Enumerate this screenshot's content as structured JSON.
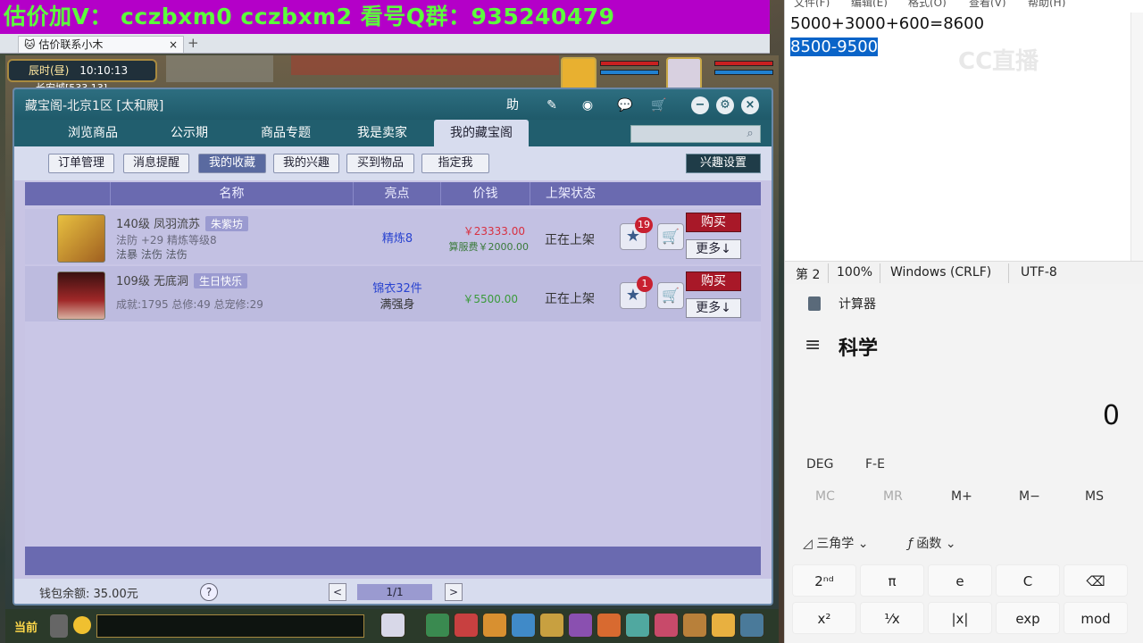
{
  "banner": {
    "text": "估价加V： cczbxm0   cczbxm2   看号Q群：935240479"
  },
  "browser": {
    "tab_label": "估价联系小木",
    "tab_close": "×",
    "tab_new": "+"
  },
  "game": {
    "time_label": "辰时(昼)",
    "clock": "10:10:13",
    "location": "长安城[533,13]",
    "chat_label": "当前"
  },
  "treasure": {
    "title": "藏宝阁-北京1区 [太和殿]",
    "help_label": "助",
    "nav_tabs": [
      {
        "label": "浏览商品"
      },
      {
        "label": "公示期"
      },
      {
        "label": "商品专题"
      },
      {
        "label": "我是卖家"
      },
      {
        "label": "我的藏宝阁"
      }
    ],
    "sub_tabs": [
      {
        "label": "订单管理"
      },
      {
        "label": "消息提醒"
      },
      {
        "label": "我的收藏"
      },
      {
        "label": "我的兴趣"
      },
      {
        "label": "买到物品"
      },
      {
        "label": "指定我"
      }
    ],
    "interest_settings": "兴趣设置",
    "columns": {
      "name": "名称",
      "highlight": "亮点",
      "price": "价钱",
      "status": "上架状态"
    },
    "rows": [
      {
        "name": "140级  凤羽流苏",
        "tag": "朱紫坊",
        "line1": "法防 +29  精炼等级8",
        "line2": "法暴  法伤  法伤",
        "highlight": "精炼8",
        "highlight2": "",
        "price": "￥23333.00",
        "fee": "算服费￥2000.00",
        "status": "正在上架",
        "fav_count": "19",
        "buy": "购买",
        "more": "更多↓"
      },
      {
        "name": "109级  无底洞",
        "tag": "生日快乐",
        "line1": "成就:1795  总修:49  总宠修:29",
        "line2": "",
        "highlight": "锦衣32件",
        "highlight2": "满强身",
        "price": "￥5500.00",
        "fee": "",
        "status": "正在上架",
        "fav_count": "1",
        "buy": "购买",
        "more": "更多↓"
      }
    ],
    "wallet": "钱包余额: 35.00元",
    "help": "?",
    "page": "1/1",
    "prev": "<",
    "next": ">"
  },
  "notepad": {
    "menu": [
      "文件(F)",
      "编辑(E)",
      "格式(O)",
      "查看(V)",
      "帮助(H)"
    ],
    "line1": "5000+3000+600=8600",
    "line2": "8500-9500",
    "watermark": "CC直播",
    "status": {
      "line": "第 2",
      "zoom": "100%",
      "eol": "Windows (CRLF)",
      "encoding": "UTF-8"
    }
  },
  "calculator": {
    "app_title": "计算器",
    "mode": "科学",
    "display": "0",
    "angle": "DEG",
    "fe": "F-E",
    "memory": [
      "MC",
      "MR",
      "M+",
      "M−",
      "MS"
    ],
    "trig": "三角学",
    "func": "函数",
    "keys_row1": [
      "2ⁿᵈ",
      "π",
      "e",
      "C",
      "⌫"
    ],
    "keys_row2": [
      "x²",
      "¹⁄x",
      "|x|",
      "exp",
      "mod"
    ]
  },
  "colors": {
    "banner_bg": "#b400c8",
    "banner_text": "#5cff3c",
    "window_title": "#1f5a6a",
    "buy": "#a81828",
    "price_red": "#d83040",
    "price_green": "#3a9a3a",
    "selection": "#0a64c8"
  }
}
